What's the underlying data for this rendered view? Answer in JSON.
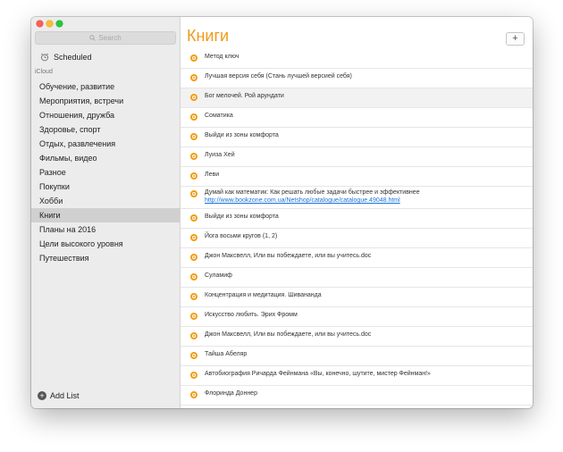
{
  "sidebar": {
    "search_placeholder": "Search",
    "scheduled": "Scheduled",
    "section_label": "iCloud",
    "lists": [
      "Обучение, развитие",
      "Мероприятия, встречи",
      "Отношения, дружба",
      "Здоровье, спорт",
      "Отдых, развлечения",
      "Фильмы, видео",
      "Разное",
      "Покупки",
      "Хобби",
      "Книги",
      "Планы на 2016",
      "Цели высокого уровня",
      "Путешествия"
    ],
    "selected_index": 9,
    "add_list": "Add List"
  },
  "main": {
    "title": "Книги",
    "add_button": "+",
    "accent_color": "#f09a17",
    "items": [
      {
        "text": "Метод ключ"
      },
      {
        "text": "Лучшая версия себя (Стань лучшей версией себя)"
      },
      {
        "text": "Бог мелочей. Рой арундати"
      },
      {
        "text": "Соматика"
      },
      {
        "text": "Выйди из зоны комфорта"
      },
      {
        "text": "Луиза Хей"
      },
      {
        "text": "Леви"
      },
      {
        "text": "Думай как математик: Как решать любые задачи быстрее и эффективнее",
        "link": "http://www.bookzone.com.ua/Netshop/catalogue/catalogue.49048.html"
      },
      {
        "text": "Выйди из зоны комфорта"
      },
      {
        "text": "Йога восьми кругов (1, 2)"
      },
      {
        "text": "Джон Максвелл, Или вы побеждаете, или вы учитесь.doc"
      },
      {
        "text": "Суламиф"
      },
      {
        "text": "Концентрация и медитация. Шивананда"
      },
      {
        "text": "Искусство любить. Эрих Фромм"
      },
      {
        "text": "Джон Максвелл, Или вы побеждаете, или вы учитесь.doc"
      },
      {
        "text": "Тайша Абеляр"
      },
      {
        "text": "Автобиография Ричарда Фейнмана «Вы, конечно, шутите, мистер Фейнман!»"
      },
      {
        "text": "Флоринда Доннер"
      }
    ]
  }
}
